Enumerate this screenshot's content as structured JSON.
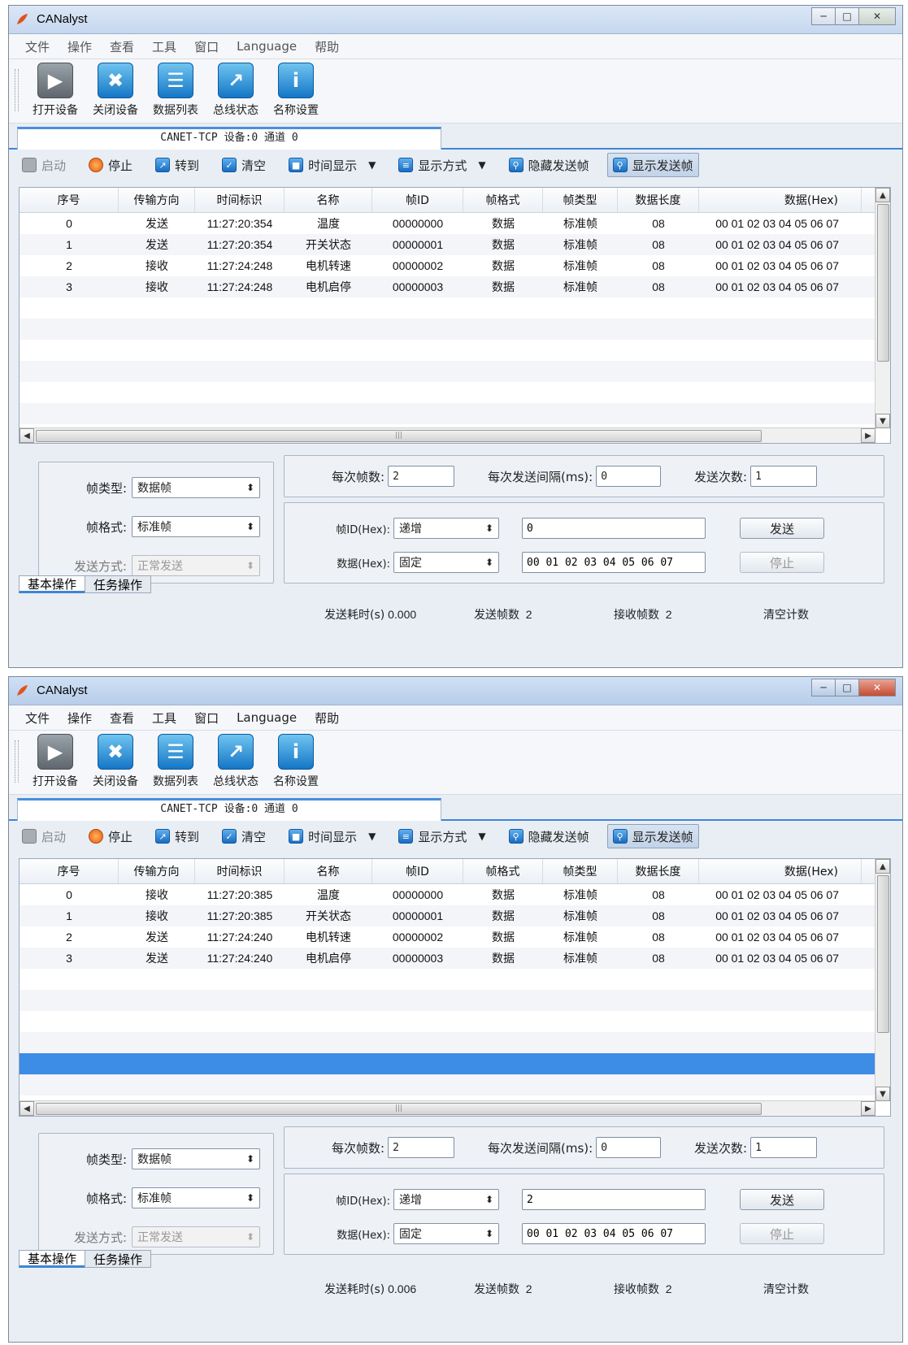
{
  "windows": [
    {
      "title": "CANalyst",
      "menu": [
        "文件",
        "操作",
        "查看",
        "工具",
        "窗口",
        "Language",
        "帮助"
      ],
      "toolbar": [
        "打开设备",
        "关闭设备",
        "数据列表",
        "总线状态",
        "名称设置"
      ],
      "device_tab": "CANET-TCP 设备:0 通道 0",
      "controls": {
        "start": "启动",
        "stop": "停止",
        "goto": "转到",
        "clear": "清空",
        "time_display": "时间显示",
        "display_mode": "显示方式",
        "hide_send": "隐藏发送帧",
        "show_send": "显示发送帧"
      },
      "columns": [
        "序号",
        "传输方向",
        "时间标识",
        "名称",
        "帧ID",
        "帧格式",
        "帧类型",
        "数据长度",
        "数据(Hex)"
      ],
      "rows": [
        [
          "0",
          "发送",
          "11:27:20:354",
          "温度",
          "00000000",
          "数据",
          "标准帧",
          "08",
          "00 01 02 03 04 05 06 07"
        ],
        [
          "1",
          "发送",
          "11:27:20:354",
          "开关状态",
          "00000001",
          "数据",
          "标准帧",
          "08",
          "00 01 02 03 04 05 06 07"
        ],
        [
          "2",
          "接收",
          "11:27:24:248",
          "电机转速",
          "00000002",
          "数据",
          "标准帧",
          "08",
          "00 01 02 03 04 05 06 07"
        ],
        [
          "3",
          "接收",
          "11:27:24:248",
          "电机启停",
          "00000003",
          "数据",
          "标准帧",
          "08",
          "00 01 02 03 04 05 06 07"
        ]
      ],
      "selected_row_index": null,
      "form": {
        "frame_type_label": "帧类型:",
        "frame_type_value": "数据帧",
        "frame_format_label": "帧格式:",
        "frame_format_value": "标准帧",
        "send_mode_label": "发送方式:",
        "send_mode_value": "正常发送",
        "frames_per_label": "每次帧数:",
        "frames_per_value": "2",
        "interval_label": "每次发送间隔(ms):",
        "interval_value": "0",
        "count_label": "发送次数:",
        "count_value": "1",
        "frame_id_label": "帧ID(Hex):",
        "frame_id_mode": "递增",
        "frame_id_value": "0",
        "data_label": "数据(Hex):",
        "data_mode": "固定",
        "data_value": "00 01 02 03 04 05 06 07",
        "send_button": "发送",
        "stop_button": "停止"
      },
      "bottom_tabs": [
        "基本操作",
        "任务操作"
      ],
      "status": {
        "send_time_label": "发送耗时(s)",
        "send_time_value": "0.000",
        "sent_label": "发送帧数",
        "sent_value": "2",
        "recv_label": "接收帧数",
        "recv_value": "2",
        "clear_counts": "清空计数"
      }
    },
    {
      "title": "CANalyst",
      "menu": [
        "文件",
        "操作",
        "查看",
        "工具",
        "窗口",
        "Language",
        "帮助"
      ],
      "toolbar": [
        "打开设备",
        "关闭设备",
        "数据列表",
        "总线状态",
        "名称设置"
      ],
      "device_tab": "CANET-TCP 设备:0 通道 0",
      "controls": {
        "start": "启动",
        "stop": "停止",
        "goto": "转到",
        "clear": "清空",
        "time_display": "时间显示",
        "display_mode": "显示方式",
        "hide_send": "隐藏发送帧",
        "show_send": "显示发送帧"
      },
      "columns": [
        "序号",
        "传输方向",
        "时间标识",
        "名称",
        "帧ID",
        "帧格式",
        "帧类型",
        "数据长度",
        "数据(Hex)"
      ],
      "rows": [
        [
          "0",
          "接收",
          "11:27:20:385",
          "温度",
          "00000000",
          "数据",
          "标准帧",
          "08",
          "00 01 02 03 04 05 06 07"
        ],
        [
          "1",
          "接收",
          "11:27:20:385",
          "开关状态",
          "00000001",
          "数据",
          "标准帧",
          "08",
          "00 01 02 03 04 05 06 07"
        ],
        [
          "2",
          "发送",
          "11:27:24:240",
          "电机转速",
          "00000002",
          "数据",
          "标准帧",
          "08",
          "00 01 02 03 04 05 06 07"
        ],
        [
          "3",
          "发送",
          "11:27:24:240",
          "电机启停",
          "00000003",
          "数据",
          "标准帧",
          "08",
          "00 01 02 03 04 05 06 07"
        ]
      ],
      "selected_row_index": 8,
      "form": {
        "frame_type_label": "帧类型:",
        "frame_type_value": "数据帧",
        "frame_format_label": "帧格式:",
        "frame_format_value": "标准帧",
        "send_mode_label": "发送方式:",
        "send_mode_value": "正常发送",
        "frames_per_label": "每次帧数:",
        "frames_per_value": "2",
        "interval_label": "每次发送间隔(ms):",
        "interval_value": "0",
        "count_label": "发送次数:",
        "count_value": "1",
        "frame_id_label": "帧ID(Hex):",
        "frame_id_mode": "递增",
        "frame_id_value": "2",
        "data_label": "数据(Hex):",
        "data_mode": "固定",
        "data_value": "00 01 02 03 04 05 06 07",
        "send_button": "发送",
        "stop_button": "停止"
      },
      "bottom_tabs": [
        "基本操作",
        "任务操作"
      ],
      "status": {
        "send_time_label": "发送耗时(s)",
        "send_time_value": "0.006",
        "sent_label": "发送帧数",
        "sent_value": "2",
        "recv_label": "接收帧数",
        "recv_value": "2",
        "clear_counts": "清空计数"
      }
    }
  ]
}
